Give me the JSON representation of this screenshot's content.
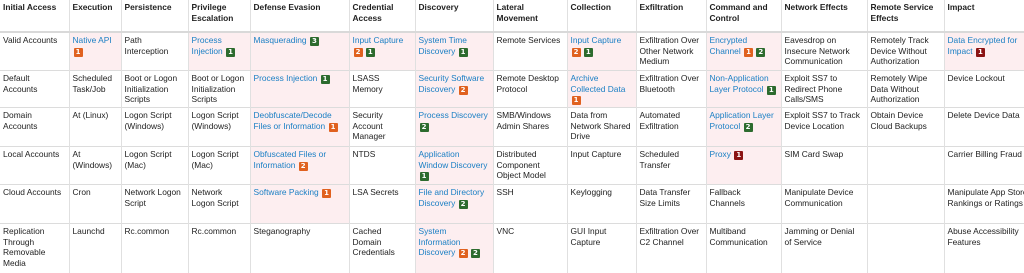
{
  "colors": {
    "link": "#1a7fc4",
    "highlight": "#fdeef0",
    "orange": "#e0611f",
    "green": "#2d6b2e",
    "red": "#8b1414"
  },
  "columns": [
    "Initial Access",
    "Execution",
    "Persistence",
    "Privilege Escalation",
    "Defense Evasion",
    "Credential Access",
    "Discovery",
    "Lateral Movement",
    "Collection",
    "Exfiltration",
    "Command and Control",
    "Network Effects",
    "Remote Service Effects",
    "Impact"
  ],
  "rows": [
    [
      {
        "text": "Valid Accounts"
      },
      {
        "text": "Native API",
        "link": true,
        "hl": true,
        "badges": [
          {
            "n": "1",
            "c": "orange"
          }
        ]
      },
      {
        "text": "Path Interception"
      },
      {
        "text": "Process Injection",
        "link": true,
        "hl": true,
        "badges": [
          {
            "n": "1",
            "c": "green"
          }
        ]
      },
      {
        "text": "Masquerading",
        "link": true,
        "hl": true,
        "badges": [
          {
            "n": "3",
            "c": "green"
          }
        ]
      },
      {
        "text": "Input Capture",
        "link": true,
        "hl": true,
        "badges": [
          {
            "n": "2",
            "c": "orange"
          },
          {
            "n": "1",
            "c": "green"
          }
        ]
      },
      {
        "text": "System Time Discovery",
        "link": true,
        "hl": true,
        "badges": [
          {
            "n": "1",
            "c": "green"
          }
        ]
      },
      {
        "text": "Remote Services"
      },
      {
        "text": "Input Capture",
        "link": true,
        "hl": true,
        "badges": [
          {
            "n": "2",
            "c": "orange"
          },
          {
            "n": "1",
            "c": "green"
          }
        ]
      },
      {
        "text": "Exfiltration Over Other Network Medium"
      },
      {
        "text": "Encrypted Channel",
        "link": true,
        "hl": true,
        "badges": [
          {
            "n": "1",
            "c": "orange"
          },
          {
            "n": "2",
            "c": "green"
          }
        ]
      },
      {
        "text": "Eavesdrop on Insecure Network Communication"
      },
      {
        "text": "Remotely Track Device Without Authorization"
      },
      {
        "text": "Data Encrypted for Impact",
        "link": true,
        "hl": true,
        "badges": [
          {
            "n": "1",
            "c": "red"
          }
        ]
      }
    ],
    [
      {
        "text": "Default Accounts"
      },
      {
        "text": "Scheduled Task/Job"
      },
      {
        "text": "Boot or Logon Initialization Scripts"
      },
      {
        "text": "Boot or Logon Initialization Scripts"
      },
      {
        "text": "Process Injection",
        "link": true,
        "hl": true,
        "badges": [
          {
            "n": "1",
            "c": "green"
          }
        ]
      },
      {
        "text": "LSASS Memory"
      },
      {
        "text": "Security Software Discovery",
        "link": true,
        "hl": true,
        "badges": [
          {
            "n": "2",
            "c": "orange"
          }
        ]
      },
      {
        "text": "Remote Desktop Protocol"
      },
      {
        "text": "Archive Collected Data",
        "link": true,
        "hl": true,
        "badges": [
          {
            "n": "1",
            "c": "orange"
          }
        ]
      },
      {
        "text": "Exfiltration Over Bluetooth"
      },
      {
        "text": "Non-Application Layer Protocol",
        "link": true,
        "hl": true,
        "badges": [
          {
            "n": "1",
            "c": "green"
          }
        ]
      },
      {
        "text": "Exploit SS7 to Redirect Phone Calls/SMS"
      },
      {
        "text": "Remotely Wipe Data Without Authorization"
      },
      {
        "text": "Device Lockout"
      }
    ],
    [
      {
        "text": "Domain Accounts"
      },
      {
        "text": "At (Linux)"
      },
      {
        "text": "Logon Script (Windows)"
      },
      {
        "text": "Logon Script (Windows)"
      },
      {
        "text": "Deobfuscate/Decode Files or Information",
        "link": true,
        "hl": true,
        "badges": [
          {
            "n": "1",
            "c": "orange"
          }
        ]
      },
      {
        "text": "Security Account Manager"
      },
      {
        "text": "Process Discovery",
        "link": true,
        "hl": true,
        "badges": [
          {
            "n": "2",
            "c": "green"
          }
        ]
      },
      {
        "text": "SMB/Windows Admin Shares"
      },
      {
        "text": "Data from Network Shared Drive"
      },
      {
        "text": "Automated Exfiltration"
      },
      {
        "text": "Application Layer Protocol",
        "link": true,
        "hl": true,
        "badges": [
          {
            "n": "2",
            "c": "green"
          }
        ]
      },
      {
        "text": "Exploit SS7 to Track Device Location"
      },
      {
        "text": "Obtain Device Cloud Backups"
      },
      {
        "text": "Delete Device Data"
      }
    ],
    [
      {
        "text": "Local Accounts"
      },
      {
        "text": "At (Windows)"
      },
      {
        "text": "Logon Script (Mac)"
      },
      {
        "text": "Logon Script (Mac)"
      },
      {
        "text": "Obfuscated Files or Information",
        "link": true,
        "hl": true,
        "badges": [
          {
            "n": "2",
            "c": "orange"
          }
        ]
      },
      {
        "text": "NTDS"
      },
      {
        "text": "Application Window Discovery",
        "link": true,
        "hl": true,
        "badges": [
          {
            "n": "1",
            "c": "green"
          }
        ]
      },
      {
        "text": "Distributed Component Object Model"
      },
      {
        "text": "Input Capture"
      },
      {
        "text": "Scheduled Transfer"
      },
      {
        "text": "Proxy",
        "link": true,
        "hl": true,
        "badges": [
          {
            "n": "1",
            "c": "red"
          }
        ]
      },
      {
        "text": "SIM Card Swap"
      },
      {
        "text": ""
      },
      {
        "text": "Carrier Billing Fraud"
      }
    ],
    [
      {
        "text": "Cloud Accounts"
      },
      {
        "text": "Cron"
      },
      {
        "text": "Network Logon Script"
      },
      {
        "text": "Network Logon Script"
      },
      {
        "text": "Software Packing",
        "link": true,
        "hl": true,
        "badges": [
          {
            "n": "1",
            "c": "orange"
          }
        ]
      },
      {
        "text": "LSA Secrets"
      },
      {
        "text": "File and Directory Discovery",
        "link": true,
        "hl": true,
        "badges": [
          {
            "n": "2",
            "c": "green"
          }
        ]
      },
      {
        "text": "SSH"
      },
      {
        "text": "Keylogging"
      },
      {
        "text": "Data Transfer Size Limits"
      },
      {
        "text": "Fallback Channels"
      },
      {
        "text": "Manipulate Device Communication"
      },
      {
        "text": ""
      },
      {
        "text": "Manipulate App Store Rankings or Ratings"
      }
    ],
    [
      {
        "text": "Replication Through Removable Media"
      },
      {
        "text": "Launchd"
      },
      {
        "text": "Rc.common"
      },
      {
        "text": "Rc.common"
      },
      {
        "text": "Steganography"
      },
      {
        "text": "Cached Domain Credentials"
      },
      {
        "text": "System Information Discovery",
        "link": true,
        "hl": true,
        "badges": [
          {
            "n": "2",
            "c": "orange"
          },
          {
            "n": "2",
            "c": "green"
          }
        ]
      },
      {
        "text": "VNC"
      },
      {
        "text": "GUI Input Capture"
      },
      {
        "text": "Exfiltration Over C2 Channel"
      },
      {
        "text": "Multiband Communication"
      },
      {
        "text": "Jamming or Denial of Service"
      },
      {
        "text": ""
      },
      {
        "text": "Abuse Accessibility Features"
      }
    ]
  ]
}
